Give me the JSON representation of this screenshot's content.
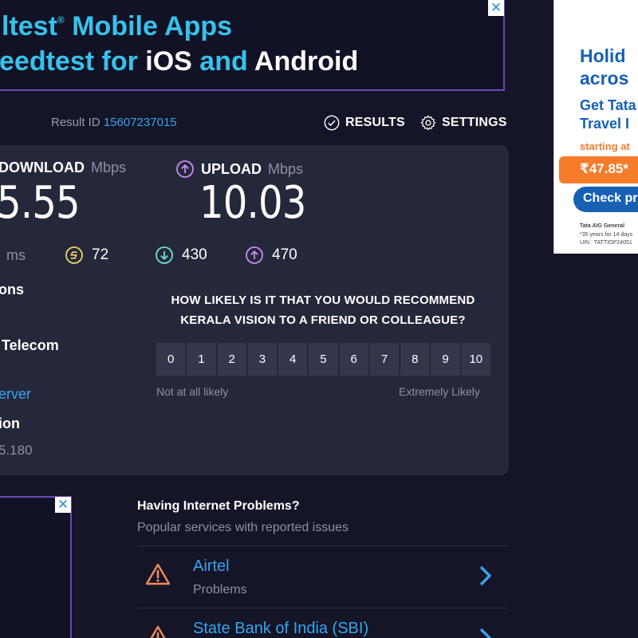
{
  "top_ad": {
    "line1_prefix": "ltest",
    "line1_reg": "®",
    "line1_suffix": " Mobile Apps",
    "line2_prefix": "eedtest for ",
    "line2_ios": "iOS",
    "line2_and": " and ",
    "line2_android": "Android",
    "close": "✕"
  },
  "result": {
    "label": "Result ID",
    "id": "15607237015"
  },
  "nav": {
    "results": "RESULTS",
    "settings": "SETTINGS"
  },
  "download": {
    "label": "DOWNLOAD",
    "unit": "Mbps",
    "value": "5.55"
  },
  "upload": {
    "label": "UPLOAD",
    "unit": "Mbps",
    "value": "10.03"
  },
  "latency": {
    "unit": "ms",
    "jitter": "72",
    "down": "430",
    "up": "470"
  },
  "info": {
    "connections": "ons",
    "isp": "Telecom",
    "server": "erver",
    "location": "ion",
    "ip": "5.180"
  },
  "survey": {
    "question_line1": "HOW LIKELY IS IT THAT YOU WOULD RECOMMEND",
    "question_line2": "KERALA VISION TO A FRIEND OR COLLEAGUE?",
    "scale": [
      "0",
      "1",
      "2",
      "3",
      "4",
      "5",
      "6",
      "7",
      "8",
      "9",
      "10"
    ],
    "low": "Not at all likely",
    "high": "Extremely Likely"
  },
  "side_ad": {
    "line1": "Holid",
    "line2": "acros",
    "line3": "Get Tata",
    "line4": "Travel I",
    "starting": "starting at",
    "price": "₹47.85*",
    "cta": "Check pr",
    "fine1": "Tata AIG General",
    "fine2": "*35 years for 14 days",
    "fine3": "UIN : TATTIOP24051"
  },
  "bl_ad": {
    "close": "✕"
  },
  "problems": {
    "title": "Having Internet Problems?",
    "subtitle": "Popular services with reported issues",
    "items": [
      {
        "name": "Airtel",
        "status": "Problems"
      },
      {
        "name": "State Bank of India (SBI)",
        "status": ""
      }
    ]
  },
  "colors": {
    "background": "#141526",
    "card": "#25283b",
    "accent_blue": "#36a5ef",
    "download_cyan": "#6fe0d3",
    "upload_purple": "#c98cf2",
    "jitter_yellow": "#e9d86a",
    "warning_orange": "#ef8a5b"
  }
}
